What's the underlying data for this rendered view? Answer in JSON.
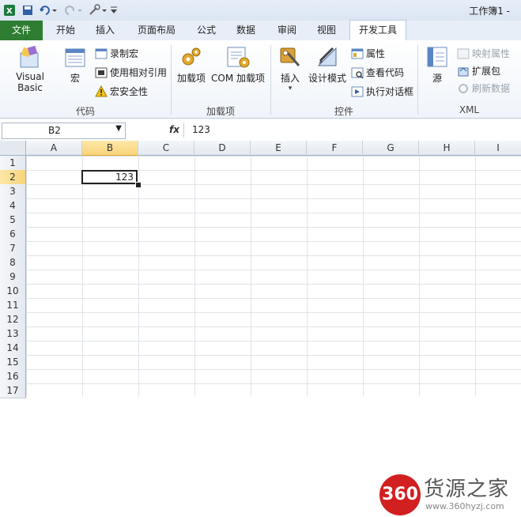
{
  "window": {
    "title": "工作簿1 -"
  },
  "tabs": [
    "文件",
    "开始",
    "插入",
    "页面布局",
    "公式",
    "数据",
    "审阅",
    "视图",
    "开发工具"
  ],
  "ribbon": {
    "code_group": {
      "label": "代码",
      "visual_basic": "Visual Basic",
      "macro": "宏",
      "record_macro": "录制宏",
      "relative_ref": "使用相对引用",
      "macro_security": "宏安全性"
    },
    "addins_group": {
      "label": "加载项",
      "addins": "加载项",
      "com_addins": "COM 加载项"
    },
    "controls_group": {
      "label": "控件",
      "insert": "插入",
      "design_mode": "设计模式",
      "properties": "属性",
      "view_code": "查看代码",
      "run_dialog": "执行对话框"
    },
    "xml_group": {
      "label": "XML",
      "source": "源",
      "map_properties": "映射属性",
      "expansion_packs": "扩展包",
      "refresh_data": "刷新数据"
    }
  },
  "formula_bar": {
    "name_box": "B2",
    "fx": "fx",
    "value": "123"
  },
  "sheet": {
    "columns": [
      "A",
      "B",
      "C",
      "D",
      "E",
      "F",
      "G",
      "H",
      "I"
    ],
    "rows": [
      "1",
      "2",
      "3",
      "4",
      "5",
      "6",
      "7",
      "8",
      "9",
      "10",
      "11",
      "12",
      "13",
      "14",
      "15",
      "16",
      "17"
    ],
    "active_cell_value": "123"
  },
  "watermark": {
    "badge": "360",
    "name": "货源之家",
    "url": "www.360hyzj.com"
  },
  "colors": {
    "file_tab": "#2e7d32",
    "selection": "#f8d47a",
    "badge": "#d21f1f"
  }
}
